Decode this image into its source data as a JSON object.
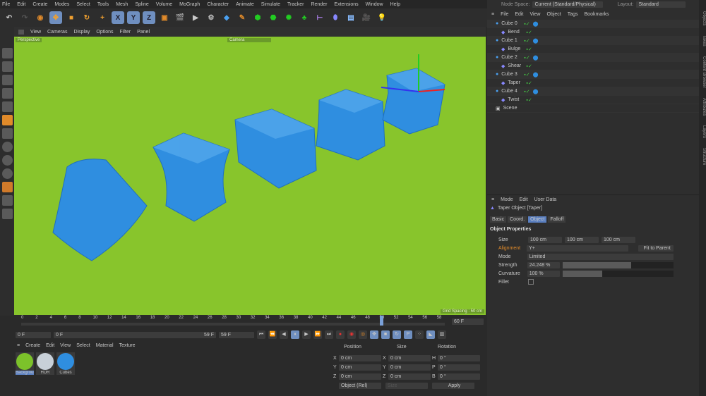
{
  "menu": [
    "File",
    "Edit",
    "Create",
    "Modes",
    "Select",
    "Tools",
    "Mesh",
    "Spline",
    "Volume",
    "MoGraph",
    "Character",
    "Animate",
    "Simulate",
    "Tracker",
    "Render",
    "Extensions",
    "Window",
    "Help"
  ],
  "toolbar": {
    "x": "X",
    "y": "Y",
    "z": "Z"
  },
  "viewport_menu": [
    "View",
    "Cameras",
    "Display",
    "Options",
    "Filter",
    "Panel"
  ],
  "viewport": {
    "label": "Perspective",
    "camera": "Camera",
    "grid": "Grid Spacing : 50 cm",
    "colors": {
      "bg": "#88c52c",
      "cube": "#2f8ee0"
    }
  },
  "header": {
    "node_space_label": "Node Space:",
    "node_space": "Current (Standard/Physical)",
    "layout_label": "Layout:",
    "layout": "Standard"
  },
  "objects_menu": [
    "File",
    "Edit",
    "View",
    "Object",
    "Tags",
    "Bookmarks"
  ],
  "objects": [
    {
      "name": "Cube 0",
      "child": "Bend"
    },
    {
      "name": "Cube 1",
      "child": "Bulge"
    },
    {
      "name": "Cube 2",
      "child": "Shear"
    },
    {
      "name": "Cube 3",
      "child": "Taper"
    },
    {
      "name": "Cube 4",
      "child": "Twist"
    }
  ],
  "scene": "Scene",
  "side_tabs": [
    "Objects",
    "Takes",
    "Content Browser",
    "Attributes",
    "Layers",
    "Structure"
  ],
  "attr": {
    "menu": [
      "Mode",
      "Edit",
      "User Data"
    ],
    "title": "Taper Object [Taper]",
    "tabs": [
      "Basic",
      "Coord.",
      "Object",
      "Falloff"
    ],
    "section": "Object Properties",
    "size_label": "Size",
    "size": [
      "100 cm",
      "100 cm",
      "100 cm"
    ],
    "alignment_label": "Alignment",
    "alignment": "Y+",
    "fit": "Fit to Parent",
    "mode_label": "Mode",
    "mode": "Limited",
    "strength_label": "Strength",
    "strength": "24.248 %",
    "strength_frac": 0.24,
    "curvature_label": "Curvature",
    "curvature": "100 %",
    "curvature_frac": 1.0,
    "fillet_label": "Fillet"
  },
  "timeline": {
    "ticks": [
      "0",
      "2",
      "4",
      "6",
      "8",
      "10",
      "12",
      "14",
      "16",
      "18",
      "20",
      "22",
      "24",
      "26",
      "28",
      "30",
      "32",
      "34",
      "36",
      "38",
      "40",
      "42",
      "44",
      "46",
      "48",
      "50",
      "52",
      "54",
      "56",
      "58"
    ],
    "current": 50,
    "end": "60 F",
    "start_field": "0 F",
    "range_start": "0 F",
    "range_end": "59 F",
    "end_field": "59 F"
  },
  "materials": {
    "menu": [
      "Create",
      "Edit",
      "View",
      "Select",
      "Material",
      "Texture"
    ],
    "items": [
      {
        "name": "Background",
        "color": "#7cc22a"
      },
      {
        "name": "HDR",
        "color": "#c8d0d8"
      },
      {
        "name": "Cubes",
        "color": "#2f8ee0"
      }
    ]
  },
  "coords": {
    "headers": [
      "Position",
      "Size",
      "Rotation"
    ],
    "rows": [
      [
        "X",
        "0 cm",
        "X",
        "0 cm",
        "H",
        "0 °"
      ],
      [
        "Y",
        "0 cm",
        "Y",
        "0 cm",
        "P",
        "0 °"
      ],
      [
        "Z",
        "0 cm",
        "Z",
        "0 cm",
        "B",
        "0 °"
      ]
    ],
    "mode": "Object (Rel)",
    "size_mode": "Size",
    "apply": "Apply"
  }
}
